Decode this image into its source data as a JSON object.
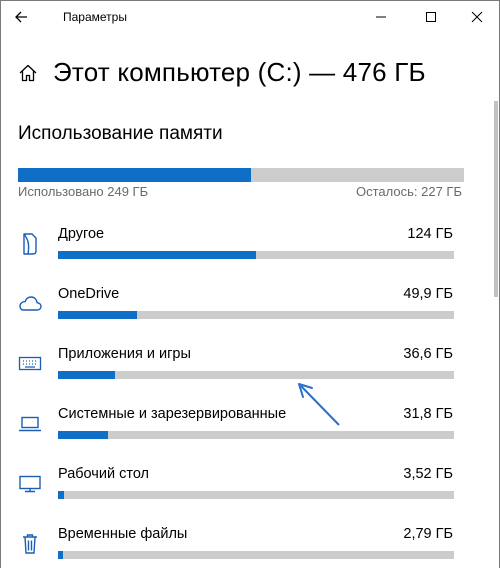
{
  "window": {
    "title": "Параметры"
  },
  "header": {
    "title": "Этот компьютер (C:) — 476 ГБ"
  },
  "usage": {
    "section_title": "Использование памяти",
    "used_label": "Использовано 249 ГБ",
    "free_label": "Осталось: 227 ГБ",
    "used_fraction": 0.523
  },
  "categories": [
    {
      "label": "Другое",
      "size": "124 ГБ",
      "icon": "document-icon",
      "fraction": 0.5
    },
    {
      "label": "OneDrive",
      "size": "49,9 ГБ",
      "icon": "cloud-icon",
      "fraction": 0.2
    },
    {
      "label": "Приложения и игры",
      "size": "36,6 ГБ",
      "icon": "keyboard-icon",
      "fraction": 0.145
    },
    {
      "label": "Системные и зарезервированные",
      "size": "31,8 ГБ",
      "icon": "laptop-icon",
      "fraction": 0.126
    },
    {
      "label": "Рабочий стол",
      "size": "3,52 ГБ",
      "icon": "monitor-icon",
      "fraction": 0.014
    },
    {
      "label": "Временные файлы",
      "size": "2,79 ГБ",
      "icon": "trash-icon",
      "fraction": 0.011
    }
  ],
  "colors": {
    "accent": "#0f6ec6",
    "bar_track": "#cccccc",
    "annotation_arrow": "#2a6fc9"
  }
}
